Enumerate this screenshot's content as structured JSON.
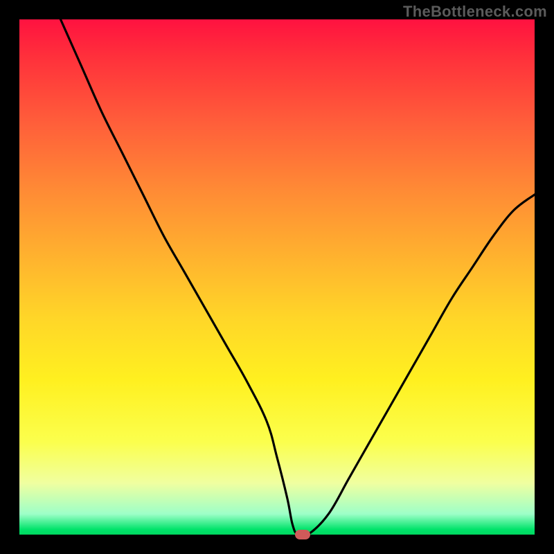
{
  "watermark": "TheBottleneck.com",
  "colors": {
    "page_bg": "#000000",
    "curve": "#000000",
    "marker": "#cf5a5a",
    "gradient_top": "#ff1240",
    "gradient_bottom": "#00d860"
  },
  "chart_data": {
    "type": "line",
    "title": "",
    "xlabel": "",
    "ylabel": "",
    "xlim": [
      0,
      100
    ],
    "ylim": [
      0,
      100
    ],
    "grid": false,
    "legend": false,
    "series": [
      {
        "name": "bottleneck-curve",
        "x": [
          8,
          12,
          16,
          20,
          24,
          28,
          32,
          36,
          40,
          44,
          48,
          50,
          52,
          53,
          54,
          56,
          60,
          64,
          68,
          72,
          76,
          80,
          84,
          88,
          92,
          96,
          100
        ],
        "y": [
          100,
          91,
          82,
          74,
          66,
          58,
          51,
          44,
          37,
          30,
          22,
          15,
          7,
          2,
          0,
          0,
          4,
          11,
          18,
          25,
          32,
          39,
          46,
          52,
          58,
          63,
          66
        ]
      }
    ],
    "marker": {
      "x": 55,
      "y": 0
    },
    "background": "rainbow-vertical-gradient"
  }
}
